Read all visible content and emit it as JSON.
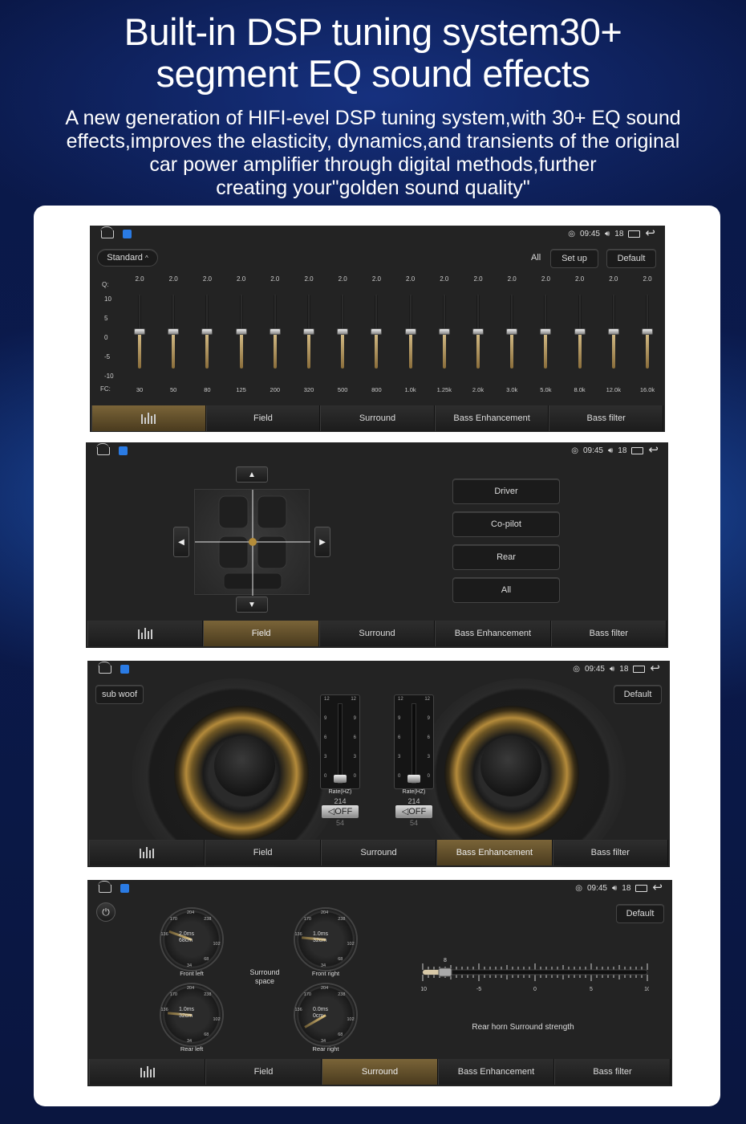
{
  "header": {
    "title_line1": "Built-in DSP tuning system30+",
    "title_line2": "segment EQ sound effects",
    "subtitle_line1": "A new generation of HIFI-evel DSP tuning system,with 30+ EQ sound",
    "subtitle_line2": "effects,improves the elasticity, dynamics,and transients of the original",
    "subtitle_line3": "car power amplifier through digital methods,further",
    "subtitle_line4": "creating your\"golden sound quality\""
  },
  "status": {
    "time": "09:45",
    "volume": "18"
  },
  "tabs": {
    "field": "Field",
    "surround": "Surround",
    "bass_enhancement": "Bass Enhancement",
    "bass_filter": "Bass filter"
  },
  "screen_eq": {
    "preset": "Standard",
    "all_label": "All",
    "setup_label": "Set up",
    "default_label": "Default",
    "q_label": "Q:",
    "fc_label": "FC:",
    "y_ticks": [
      "10",
      "5",
      "0",
      "-5",
      "-10"
    ],
    "bands": [
      {
        "q": "2.0",
        "fc": "30",
        "gain": 0
      },
      {
        "q": "2.0",
        "fc": "50",
        "gain": 0
      },
      {
        "q": "2.0",
        "fc": "80",
        "gain": 0
      },
      {
        "q": "2.0",
        "fc": "125",
        "gain": 0
      },
      {
        "q": "2.0",
        "fc": "200",
        "gain": 0
      },
      {
        "q": "2.0",
        "fc": "320",
        "gain": 0
      },
      {
        "q": "2.0",
        "fc": "500",
        "gain": 0
      },
      {
        "q": "2.0",
        "fc": "800",
        "gain": 0
      },
      {
        "q": "2.0",
        "fc": "1.0k",
        "gain": 0
      },
      {
        "q": "2.0",
        "fc": "1.25k",
        "gain": 0
      },
      {
        "q": "2.0",
        "fc": "2.0k",
        "gain": 0
      },
      {
        "q": "2.0",
        "fc": "3.0k",
        "gain": 0
      },
      {
        "q": "2.0",
        "fc": "5.0k",
        "gain": 0
      },
      {
        "q": "2.0",
        "fc": "8.0k",
        "gain": 0
      },
      {
        "q": "2.0",
        "fc": "12.0k",
        "gain": 0
      },
      {
        "q": "2.0",
        "fc": "16.0k",
        "gain": 0
      }
    ]
  },
  "screen_field": {
    "buttons": [
      "Driver",
      "Co-pilot",
      "Rear",
      "All"
    ]
  },
  "screen_bass": {
    "subwoof_label": "sub woof",
    "default_label": "Default",
    "left": {
      "scale": [
        "12",
        "9",
        "6",
        "3",
        "0"
      ],
      "rate_label": "Rate(HZ)",
      "rate_top": "214",
      "switch": "OFF",
      "rate_bottom": "54"
    },
    "right": {
      "scale": [
        "12",
        "9",
        "6",
        "3",
        "0"
      ],
      "rate_label": "Rate(HZ)",
      "rate_top": "214",
      "switch": "OFF",
      "rate_bottom": "54"
    }
  },
  "screen_surround": {
    "default_label": "Default",
    "space_label_1": "Surround",
    "space_label_2": "space",
    "dials": [
      {
        "name": "Front left",
        "ms": "2.0ms",
        "cm": "68cm"
      },
      {
        "name": "Front right",
        "ms": "1.0ms",
        "cm": "32cm"
      },
      {
        "name": "Rear left",
        "ms": "1.0ms",
        "cm": "32cm"
      },
      {
        "name": "Rear right",
        "ms": "0.0ms",
        "cm": "0cm"
      }
    ],
    "dial_scale": [
      "136",
      "170",
      "204",
      "238",
      "34",
      "68",
      "102"
    ],
    "strength_label": "Rear horn Surround strength",
    "strength_value": "-8",
    "strength_ticks": [
      "-10",
      "-5",
      "0",
      "5",
      "10"
    ]
  }
}
